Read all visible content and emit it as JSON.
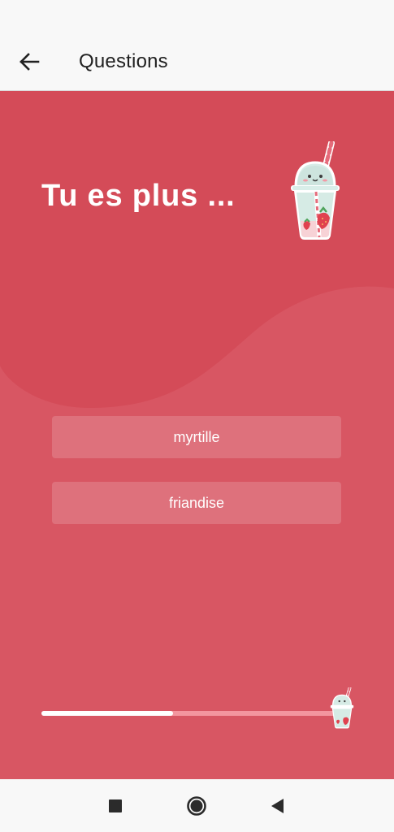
{
  "app_bar": {
    "title": "Questions",
    "back_icon": "arrow-back-icon"
  },
  "question": {
    "title": "Tu es plus ...",
    "mascot_icon": "strawberry-milkshake-icon"
  },
  "answers": [
    {
      "label": "myrtille"
    },
    {
      "label": "friandise"
    }
  ],
  "progress": {
    "fraction": 0.44,
    "marker_icon": "strawberry-milkshake-icon"
  },
  "nav_bar": {
    "icons": [
      "recents-square-icon",
      "home-circle-icon",
      "back-triangle-icon"
    ]
  },
  "colors": {
    "background": "#d85663",
    "wave": "#d44b58",
    "button": "rgba(255,255,255,0.16)",
    "progress_track": "#f3969f",
    "progress_fill": "#ffffff",
    "app_bar": "#f8f8f8"
  }
}
